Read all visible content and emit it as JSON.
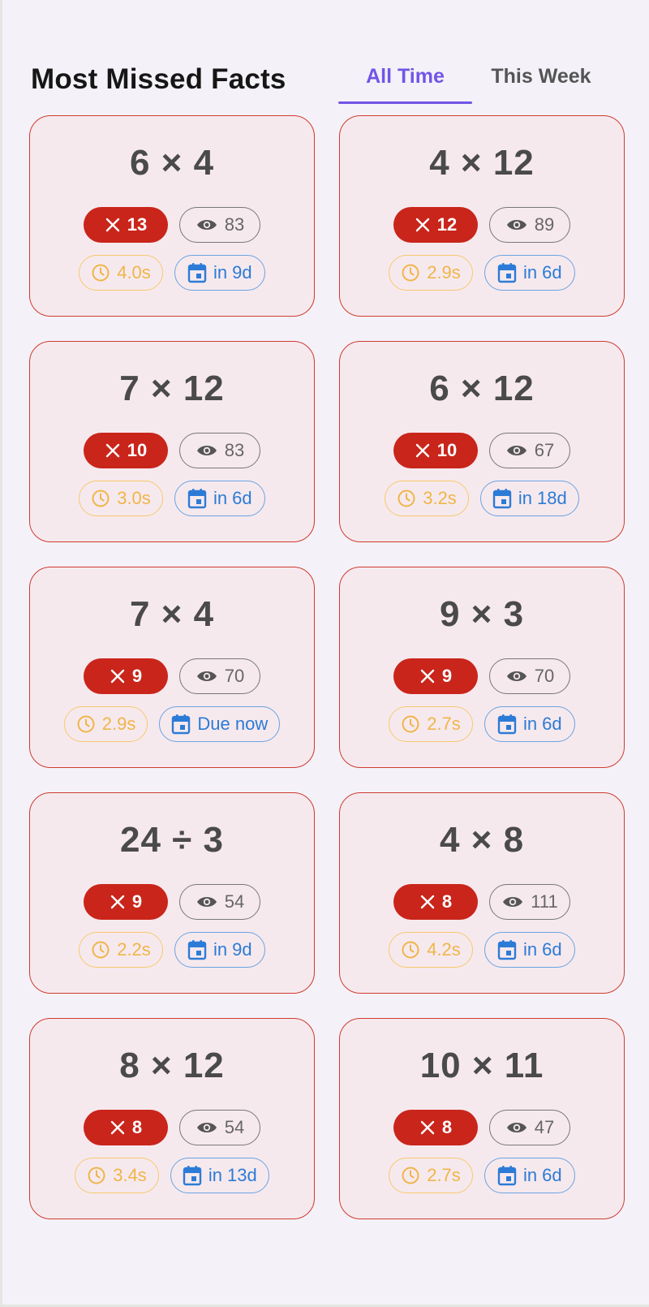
{
  "header": {
    "title": "Most Missed Facts",
    "tabs": [
      {
        "label": "All Time",
        "active": true
      },
      {
        "label": "This Week",
        "active": false
      }
    ]
  },
  "colors": {
    "accent": "#7255e6",
    "miss": "#c9251b",
    "card_border": "#cf3b30",
    "time": "#f0b548",
    "due": "#2c7bd6"
  },
  "icons": {
    "miss": "close-icon",
    "views": "eye-icon",
    "time": "clock-icon",
    "due": "calendar-icon"
  },
  "cards": [
    {
      "fact": "6 × 4",
      "misses": "13",
      "views": "83",
      "time": "4.0s",
      "due": "in 9d"
    },
    {
      "fact": "4 × 12",
      "misses": "12",
      "views": "89",
      "time": "2.9s",
      "due": "in 6d"
    },
    {
      "fact": "7 × 12",
      "misses": "10",
      "views": "83",
      "time": "3.0s",
      "due": "in 6d"
    },
    {
      "fact": "6 × 12",
      "misses": "10",
      "views": "67",
      "time": "3.2s",
      "due": "in 18d"
    },
    {
      "fact": "7 × 4",
      "misses": "9",
      "views": "70",
      "time": "2.9s",
      "due": "Due now"
    },
    {
      "fact": "9 × 3",
      "misses": "9",
      "views": "70",
      "time": "2.7s",
      "due": "in 6d"
    },
    {
      "fact": "24 ÷ 3",
      "misses": "9",
      "views": "54",
      "time": "2.2s",
      "due": "in 9d"
    },
    {
      "fact": "4 × 8",
      "misses": "8",
      "views": "111",
      "time": "4.2s",
      "due": "in 6d"
    },
    {
      "fact": "8 × 12",
      "misses": "8",
      "views": "54",
      "time": "3.4s",
      "due": "in 13d"
    },
    {
      "fact": "10 × 11",
      "misses": "8",
      "views": "47",
      "time": "2.7s",
      "due": "in 6d"
    }
  ]
}
